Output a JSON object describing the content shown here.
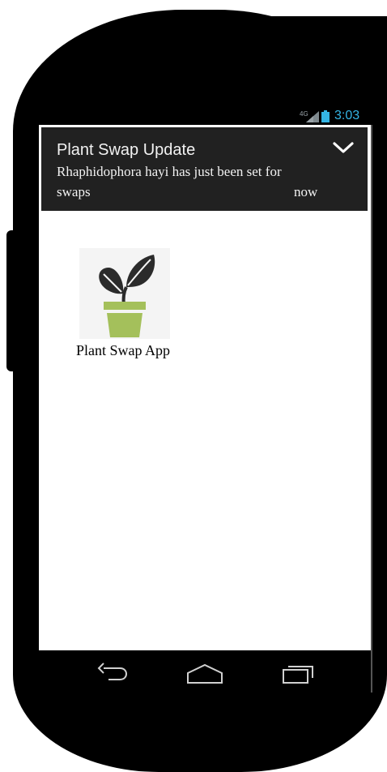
{
  "status_bar": {
    "network_label": "4G",
    "time": "3:03",
    "signal_icon": "signal-icon",
    "battery_icon": "battery-icon"
  },
  "notification": {
    "title": "Plant Swap Update",
    "message_line1": "Rhaphidophora hayi has just been set for",
    "message_line2": "swaps",
    "time": "now",
    "expand_icon": "chevron-down-icon"
  },
  "home": {
    "apps": [
      {
        "label": "Plant Swap App",
        "icon": "potted-plant-icon",
        "pot_color": "#a4c05b",
        "leaf_color": "#2b2b2b"
      }
    ]
  },
  "nav_bar": {
    "back_icon": "back-icon",
    "home_icon": "home-icon",
    "recents_icon": "recents-icon"
  },
  "colors": {
    "accent": "#34b5e5",
    "notification_bg": "#212121",
    "device": "#000000"
  }
}
